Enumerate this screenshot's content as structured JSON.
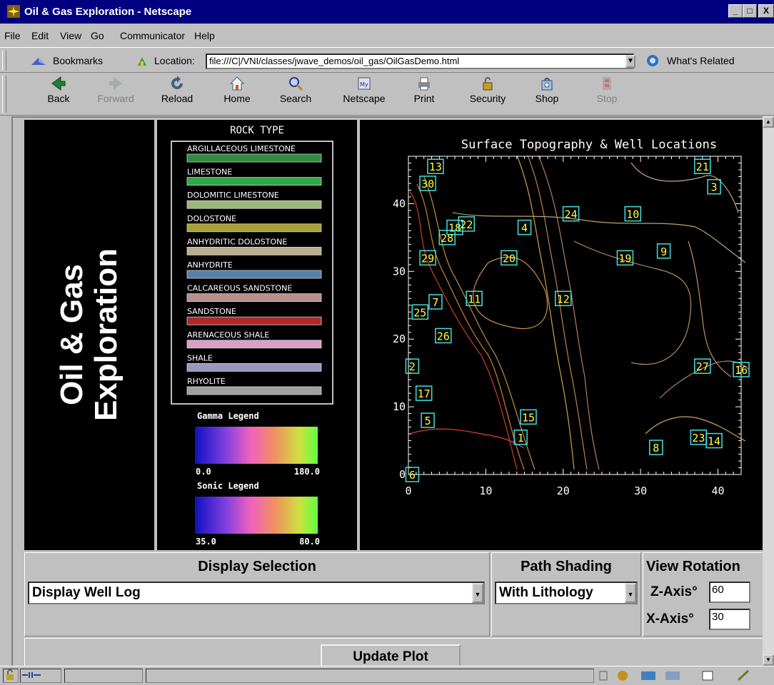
{
  "window": {
    "title": "Oil & Gas Exploration - Netscape",
    "controls": [
      "_",
      "□",
      "X"
    ]
  },
  "menu": [
    "File",
    "Edit",
    "View",
    "Go",
    "Communicator",
    "Help"
  ],
  "location_bar": {
    "bookmarks": "Bookmarks",
    "location_label": "Location:",
    "url": "file:///C|/VNI/classes/jwave_demos/oil_gas/OilGasDemo.html",
    "whats_related": "What's Related"
  },
  "toolbar": {
    "buttons": [
      {
        "label": "Back",
        "icon": "back-arrow-icon",
        "enabled": true
      },
      {
        "label": "Forward",
        "icon": "forward-arrow-icon",
        "enabled": false
      },
      {
        "label": "Reload",
        "icon": "reload-icon",
        "enabled": true
      },
      {
        "label": "Home",
        "icon": "home-icon",
        "enabled": true
      },
      {
        "label": "Search",
        "icon": "search-icon",
        "enabled": true
      },
      {
        "label": "Netscape",
        "icon": "netscape-icon",
        "enabled": true
      },
      {
        "label": "Print",
        "icon": "printer-icon",
        "enabled": true
      },
      {
        "label": "Security",
        "icon": "lock-icon",
        "enabled": true
      },
      {
        "label": "Shop",
        "icon": "shopping-bag-icon",
        "enabled": true
      },
      {
        "label": "Stop",
        "icon": "stop-icon",
        "enabled": false
      }
    ]
  },
  "app": {
    "title_line1": "Oil & Gas",
    "title_line2": "Exploration",
    "rock_type_header": "ROCK TYPE",
    "rock_types": [
      {
        "name": "ARGILLACEOUS LIMESTONE",
        "color": "#2e8b3e"
      },
      {
        "name": "LIMESTONE",
        "color": "#2fa84a"
      },
      {
        "name": "DOLOMITIC LIMESTONE",
        "color": "#9ab87c"
      },
      {
        "name": "DOLOSTONE",
        "color": "#a8a030"
      },
      {
        "name": "ANHYDRITIC DOLOSTONE",
        "color": "#b8b090"
      },
      {
        "name": "ANHYDRITE",
        "color": "#5580a8"
      },
      {
        "name": "CALCAREOUS SANDSTONE",
        "color": "#b89090"
      },
      {
        "name": "SANDSTONE",
        "color": "#b02828"
      },
      {
        "name": "ARENACEOUS SHALE",
        "color": "#d8a0c8"
      },
      {
        "name": "SHALE",
        "color": "#9898c0"
      },
      {
        "name": "RHYOLITE",
        "color": "#a0a0a0"
      }
    ],
    "gamma_legend": {
      "title": "Gamma Legend",
      "min": "0.0",
      "max": "180.0"
    },
    "sonic_legend": {
      "title": "Sonic Legend",
      "min": "35.0",
      "max": "80.0"
    },
    "controls": {
      "display_selection_header": "Display Selection",
      "display_selection_value": "Display Well Log",
      "path_shading_header": "Path Shading",
      "path_shading_value": "With Lithology",
      "view_rotation_header": "View Rotation",
      "z_axis_label": "Z-Axis°",
      "z_axis_value": "60",
      "x_axis_label": "X-Axis°",
      "x_axis_value": "30",
      "update_button": "Update Plot"
    }
  },
  "chart_data": {
    "type": "scatter",
    "title": "Surface Topography & Well Locations",
    "xlim": [
      0,
      43
    ],
    "ylim": [
      0,
      47
    ],
    "xticks": [
      "0",
      "10",
      "20",
      "30",
      "40"
    ],
    "yticks": [
      "0",
      "10",
      "20",
      "30",
      "40"
    ],
    "wells": [
      {
        "id": "13",
        "x": 3.5,
        "y": 45.5
      },
      {
        "id": "30",
        "x": 2.5,
        "y": 43
      },
      {
        "id": "21",
        "x": 38,
        "y": 45.5
      },
      {
        "id": "3",
        "x": 39.5,
        "y": 42.5
      },
      {
        "id": "24",
        "x": 21,
        "y": 38.5
      },
      {
        "id": "10",
        "x": 29,
        "y": 38.5
      },
      {
        "id": "4",
        "x": 15,
        "y": 36.5
      },
      {
        "id": "18",
        "x": 6,
        "y": 36.5
      },
      {
        "id": "22",
        "x": 7.5,
        "y": 37
      },
      {
        "id": "28",
        "x": 5,
        "y": 35
      },
      {
        "id": "9",
        "x": 33,
        "y": 33
      },
      {
        "id": "29",
        "x": 2.5,
        "y": 32
      },
      {
        "id": "20",
        "x": 13,
        "y": 32
      },
      {
        "id": "19",
        "x": 28,
        "y": 32
      },
      {
        "id": "7",
        "x": 3.5,
        "y": 25.5
      },
      {
        "id": "11",
        "x": 8.5,
        "y": 26
      },
      {
        "id": "12",
        "x": 20,
        "y": 26
      },
      {
        "id": "25",
        "x": 1.5,
        "y": 24
      },
      {
        "id": "26",
        "x": 4.5,
        "y": 20.5
      },
      {
        "id": "2",
        "x": 0.5,
        "y": 16
      },
      {
        "id": "27",
        "x": 38,
        "y": 16
      },
      {
        "id": "16",
        "x": 43,
        "y": 15.5
      },
      {
        "id": "17",
        "x": 2,
        "y": 12
      },
      {
        "id": "15",
        "x": 15.5,
        "y": 8.5
      },
      {
        "id": "5",
        "x": 2.5,
        "y": 8
      },
      {
        "id": "1",
        "x": 14.5,
        "y": 5.5
      },
      {
        "id": "23",
        "x": 37.5,
        "y": 5.5
      },
      {
        "id": "14",
        "x": 39.5,
        "y": 5
      },
      {
        "id": "8",
        "x": 32,
        "y": 4
      },
      {
        "id": "6",
        "x": 0.5,
        "y": 0
      }
    ]
  }
}
